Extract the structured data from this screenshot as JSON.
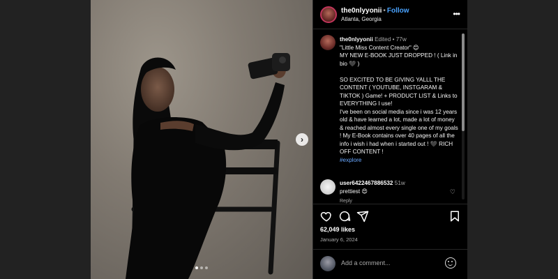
{
  "post": {
    "username": "the0nlyyonii",
    "follow_label": "Follow",
    "location": "Atlanta, Georgia",
    "more_icon": "more-horizontal-icon",
    "caption": {
      "username": "the0nlyyonii",
      "edited": "Edited",
      "age": "77w",
      "body": "\"Little Miss Content Creator\" 😊\nMY NEW E-BOOK JUST DROPPED ! ( Link in bio 🖤 )\n\nSO EXCITED TO BE GIVING YALLL THE CONTENT ( YOUTUBE, INSTGARAM & TIKTOK ) Game! + PRODUCT LIST & Links to EVERYTHING I use!\nI've been on social media since i was 12 years old & have learned a lot, made a lot of money & reached almost every single one of my goals ! My E-Book contains over 40 pages of all the info i wish i had when i started out ! 🖤  RICH OFF CONTENT !",
      "hashtag": "#explore"
    },
    "comments": [
      {
        "username": "user6422467886532",
        "age": "51w",
        "text": "prettiest 😍",
        "reply": "Reply"
      }
    ],
    "likes": "62,049 likes",
    "date": "January 6, 2024",
    "add_comment_placeholder": "Add a comment...",
    "carousel": {
      "count": 3,
      "active_index": 0
    },
    "colors": {
      "follow": "#4aa3ff",
      "panel_bg": "#000000",
      "hashtag": "#6aa8ff"
    }
  }
}
